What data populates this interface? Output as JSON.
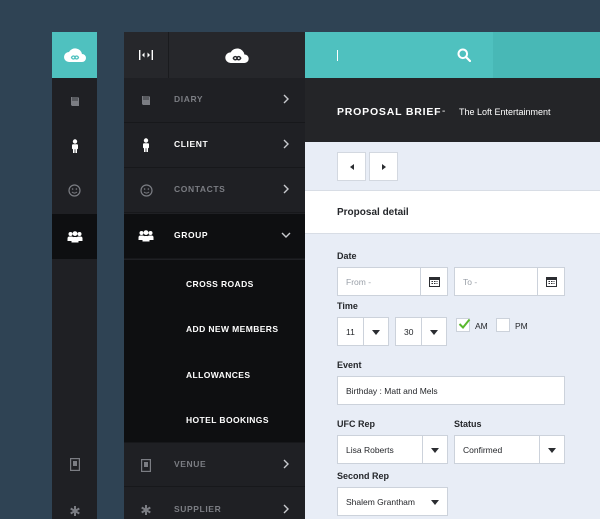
{
  "nav": {
    "items": [
      {
        "label": "DIARY",
        "icon": "book-icon"
      },
      {
        "label": "CLIENT",
        "icon": "person-icon"
      },
      {
        "label": "CONTACTS",
        "icon": "smiley-icon"
      },
      {
        "label": "GROUP",
        "icon": "group-icon"
      },
      {
        "label": "VENUE",
        "icon": "building-icon"
      },
      {
        "label": "SUPPLIER",
        "icon": "asterisk-icon"
      }
    ],
    "group_subitems": [
      "CROSS ROADS",
      "ADD NEW MEMBERS",
      "ALLOWANCES",
      "HOTEL BOOKINGS"
    ]
  },
  "header": {
    "title": "PROPOSAL BRIEF",
    "separator": "-",
    "client": "The Loft Entertainment"
  },
  "form": {
    "section_title": "Proposal detail",
    "date_label": "Date",
    "from_placeholder": "From -",
    "to_placeholder": "To -",
    "time_label": "Time",
    "hour": "11",
    "minute": "30",
    "am_label": "AM",
    "am_checked": true,
    "pm_label": "PM",
    "pm_checked": false,
    "event_label": "Event",
    "event_value": "Birthday : Matt and Mels",
    "ufc_rep_label": "UFC Rep",
    "ufc_rep_value": "Lisa Roberts",
    "status_label": "Status",
    "status_value": "Confirmed",
    "second_rep_label": "Second Rep",
    "second_rep_value": "Shalem Grantham"
  },
  "colors": {
    "accent": "#4fc1bf",
    "background": "#2f4354",
    "sidebar": "#1f2024",
    "checkmark": "#5ab82e"
  }
}
